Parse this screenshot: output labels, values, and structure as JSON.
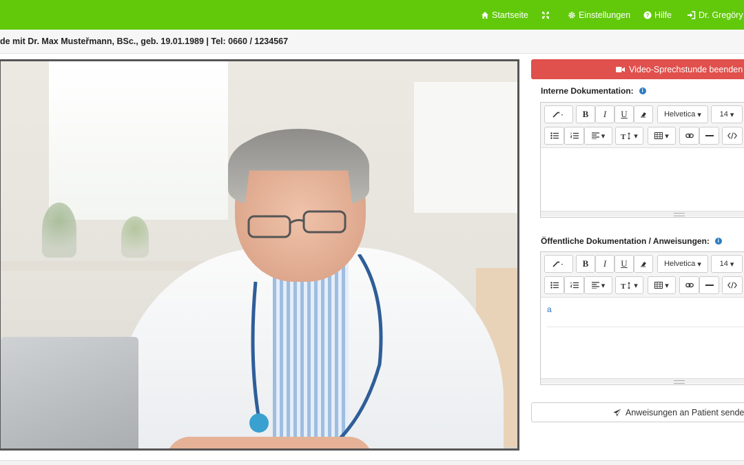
{
  "nav": {
    "home_label": "Startseite",
    "settings_label": "Einstellungen",
    "help_label": "Hilfe",
    "user_label": "Dr. Gregöry H",
    "colors": {
      "bar": "#62c90a"
    }
  },
  "titlebar": {
    "text": "de mit Dr. Max Musteřmann, BSc., geb. 19.01.1989 | Tel: 0660 / 1234567"
  },
  "video": {
    "end_button_label": "Video-Sprechstunde beenden",
    "end_button_color": "#e0504c"
  },
  "internal_doc": {
    "label": "Interne Dokumentation:",
    "content": ""
  },
  "public_doc": {
    "label": "Öffentliche Dokumentation / Anweisungen:",
    "content": "a"
  },
  "toolbar": {
    "font_name": "Helvetica",
    "font_size": "14",
    "bold": "B",
    "italic": "I",
    "underline": "U"
  },
  "send_button_label": "Anweisungen an Patient senden"
}
